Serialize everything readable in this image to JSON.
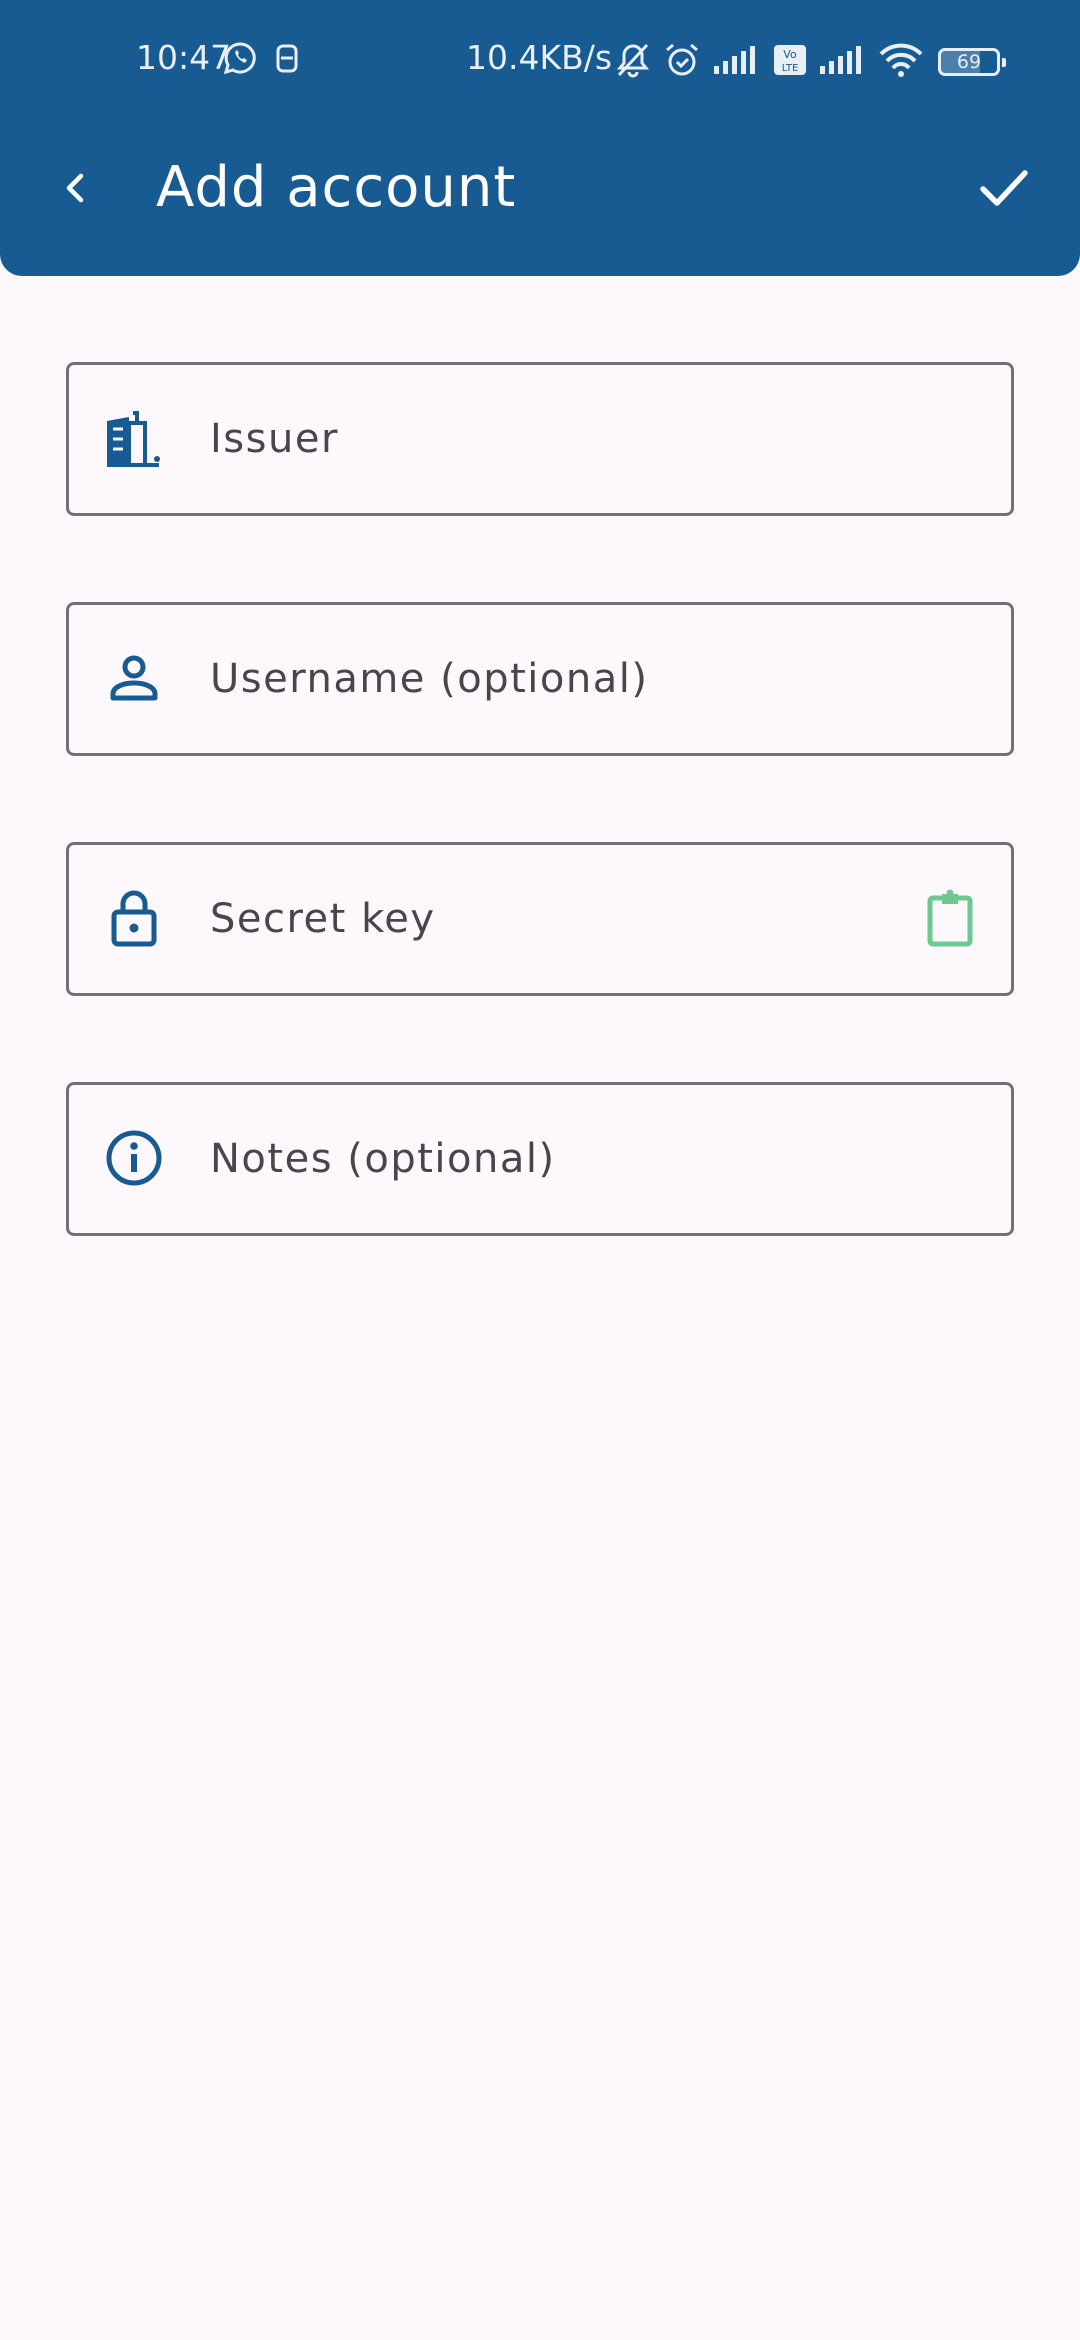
{
  "status_bar": {
    "time": "10:47",
    "network_speed": "10.4KB/s",
    "battery_level": "69",
    "left_icons": [
      "whatsapp-icon",
      "sim-card-icon"
    ],
    "right_icons": [
      "bell-off-icon",
      "alarm-icon",
      "signal-icon",
      "volte-icon",
      "signal-icon",
      "wifi-icon"
    ]
  },
  "toolbar": {
    "title": "Add account",
    "back_icon": "chevron-left-icon",
    "confirm_icon": "check-icon"
  },
  "form": {
    "issuer": {
      "placeholder": "Issuer",
      "value": "",
      "icon": "building-icon"
    },
    "username": {
      "placeholder": "Username (optional)",
      "value": "",
      "icon": "person-icon"
    },
    "secret": {
      "placeholder": "Secret key",
      "value": "",
      "icon": "lock-icon",
      "trailing_icon": "paste-clipboard-icon"
    },
    "notes": {
      "placeholder": "Notes (optional)",
      "value": "",
      "icon": "info-icon"
    }
  },
  "colors": {
    "primary": "#185A92",
    "background": "#FDF8FC",
    "outline": "#73707A",
    "paste_icon": "#6CC98F"
  }
}
